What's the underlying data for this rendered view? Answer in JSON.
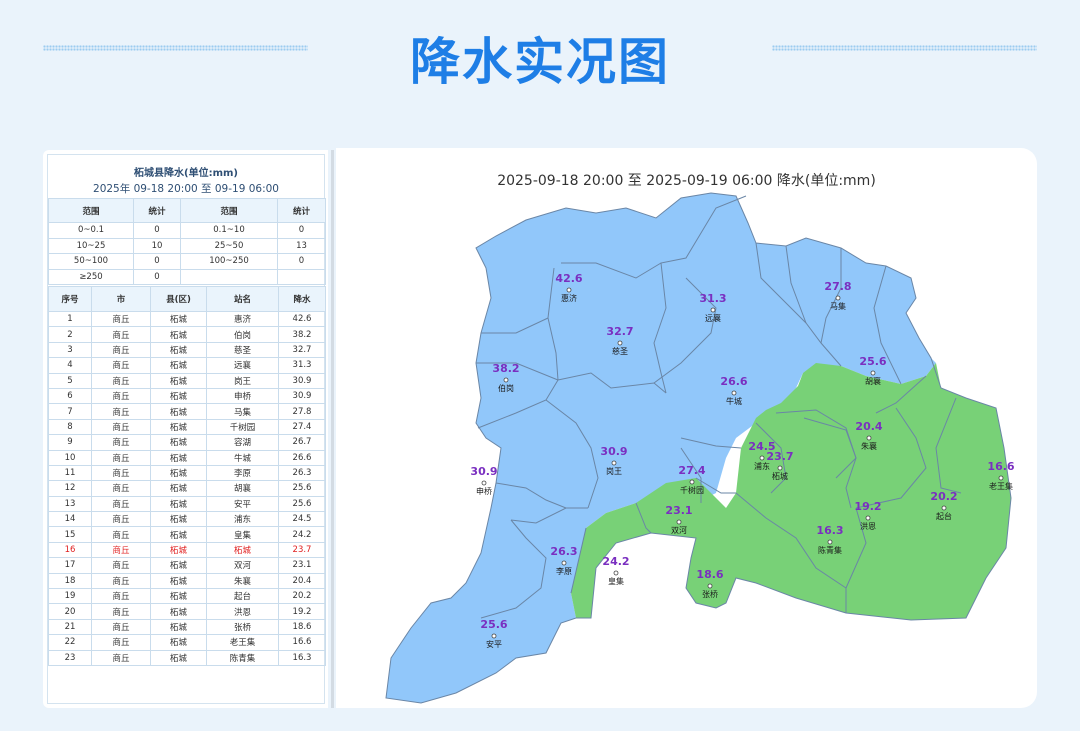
{
  "page": {
    "title": "降水实况图"
  },
  "panel": {
    "title": "柘城县降水(单位:mm)",
    "subtitle": "2025年 09-18 20:00 至 09-19 06:00",
    "stats_headers": [
      "范围",
      "统计",
      "范围",
      "统计"
    ],
    "stats_rows": [
      [
        "0~0.1",
        "0",
        "0.1~10",
        "0"
      ],
      [
        "10~25",
        "10",
        "25~50",
        "13"
      ],
      [
        "50~100",
        "0",
        "100~250",
        "0"
      ],
      [
        "≥250",
        "0",
        "",
        ""
      ]
    ],
    "table_headers": [
      "序号",
      "市",
      "县(区)",
      "站名",
      "降水"
    ],
    "rows": [
      [
        "1",
        "商丘",
        "柘城",
        "惠济",
        "42.6"
      ],
      [
        "2",
        "商丘",
        "柘城",
        "伯岗",
        "38.2"
      ],
      [
        "3",
        "商丘",
        "柘城",
        "慈圣",
        "32.7"
      ],
      [
        "4",
        "商丘",
        "柘城",
        "远襄",
        "31.3"
      ],
      [
        "5",
        "商丘",
        "柘城",
        "岗王",
        "30.9"
      ],
      [
        "6",
        "商丘",
        "柘城",
        "申桥",
        "30.9"
      ],
      [
        "7",
        "商丘",
        "柘城",
        "马集",
        "27.8"
      ],
      [
        "8",
        "商丘",
        "柘城",
        "千树园",
        "27.4"
      ],
      [
        "9",
        "商丘",
        "柘城",
        "容湖",
        "26.7"
      ],
      [
        "10",
        "商丘",
        "柘城",
        "牛城",
        "26.6"
      ],
      [
        "11",
        "商丘",
        "柘城",
        "李原",
        "26.3"
      ],
      [
        "12",
        "商丘",
        "柘城",
        "胡襄",
        "25.6"
      ],
      [
        "13",
        "商丘",
        "柘城",
        "安平",
        "25.6"
      ],
      [
        "14",
        "商丘",
        "柘城",
        "浦东",
        "24.5"
      ],
      [
        "15",
        "商丘",
        "柘城",
        "皇集",
        "24.2"
      ],
      [
        "16",
        "商丘",
        "柘城",
        "柘城",
        "23.7"
      ],
      [
        "17",
        "商丘",
        "柘城",
        "双河",
        "23.1"
      ],
      [
        "18",
        "商丘",
        "柘城",
        "朱襄",
        "20.4"
      ],
      [
        "19",
        "商丘",
        "柘城",
        "起台",
        "20.2"
      ],
      [
        "20",
        "商丘",
        "柘城",
        "洪恩",
        "19.2"
      ],
      [
        "21",
        "商丘",
        "柘城",
        "张桥",
        "18.6"
      ],
      [
        "22",
        "商丘",
        "柘城",
        "老王集",
        "16.6"
      ],
      [
        "23",
        "商丘",
        "柘城",
        "陈青集",
        "16.3"
      ]
    ],
    "highlight_row": 16
  },
  "map": {
    "title": "2025-09-18 20:00 至 2025-09-19 06:00 降水(单位:mm)",
    "colors": {
      "range_25_50": "#91c7fa",
      "range_10_25": "#78d177",
      "boundary": "#6a86a6",
      "value_text": "#7a2fc0"
    },
    "stations": [
      {
        "name": "惠济",
        "value": "42.6"
      },
      {
        "name": "伯岗",
        "value": "38.2"
      },
      {
        "name": "慈圣",
        "value": "32.7"
      },
      {
        "name": "远襄",
        "value": "31.3"
      },
      {
        "name": "岗王",
        "value": "30.9"
      },
      {
        "name": "申桥",
        "value": "30.9"
      },
      {
        "name": "马集",
        "value": "27.8"
      },
      {
        "name": "千树园",
        "value": "27.4"
      },
      {
        "name": "牛城",
        "value": "26.6"
      },
      {
        "name": "李原",
        "value": "26.3"
      },
      {
        "name": "胡襄",
        "value": "25.6"
      },
      {
        "name": "安平",
        "value": "25.6"
      },
      {
        "name": "浦东",
        "value": "24.5"
      },
      {
        "name": "皇集",
        "value": "24.2"
      },
      {
        "name": "柘城",
        "value": "23.7"
      },
      {
        "name": "双河",
        "value": "23.1"
      },
      {
        "name": "朱襄",
        "value": "20.4"
      },
      {
        "name": "起台",
        "value": "20.2"
      },
      {
        "name": "洪恩",
        "value": "19.2"
      },
      {
        "name": "张桥",
        "value": "18.6"
      },
      {
        "name": "老王集",
        "value": "16.6"
      },
      {
        "name": "陈青集",
        "value": "16.3"
      }
    ]
  }
}
